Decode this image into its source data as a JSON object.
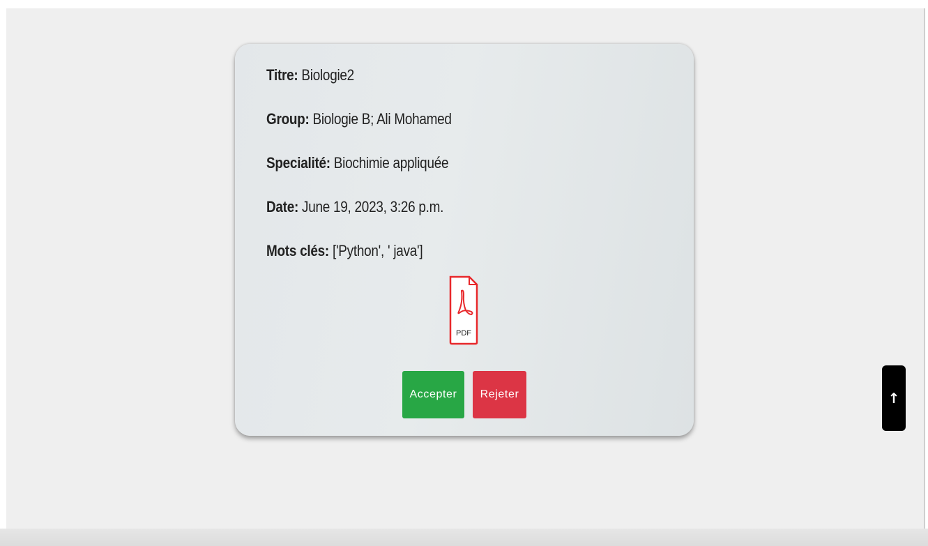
{
  "document": {
    "title_label": "Titre:",
    "title_value": " Biologie2",
    "group_label": "Group:",
    "group_value": " Biologie B; Ali Mohamed",
    "speciality_label": "Specialité:",
    "speciality_value": " Biochimie appliquée",
    "date_label": "Date:",
    "date_value": " June 19, 2023, 3:26 p.m.",
    "keywords_label": "Mots clés:",
    "keywords_value": " ['Python', ' java']",
    "pdf_icon": "pdf-file-icon",
    "pdf_text": "PDF"
  },
  "actions": {
    "accept_label": "Accepter",
    "reject_label": "Rejeter",
    "accept_color": "#28a745",
    "reject_color": "#dc3545"
  },
  "scroll_top": {
    "icon": "arrow-up-icon",
    "glyph": "↑"
  }
}
